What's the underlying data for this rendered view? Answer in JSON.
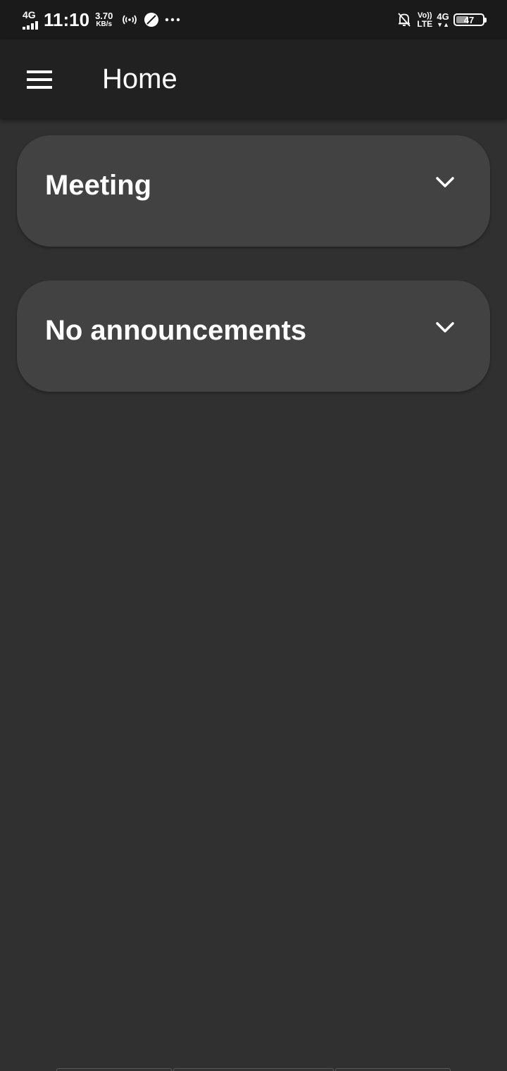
{
  "status_bar": {
    "network_left": "4G",
    "signal_level": 0.75,
    "time": "11:10",
    "speed_value": "3.70",
    "speed_unit": "KB/s",
    "volte_top": "Vo))",
    "volte_bottom": "LTE",
    "network_right": "4G",
    "network_right_arrows": "▼▲",
    "battery_percent": "47",
    "battery_level": 0.47,
    "icons": [
      "hotspot-icon",
      "leaf-app-icon",
      "more-dots-icon",
      "bell-off-icon"
    ],
    "overflow_dots": "•••"
  },
  "app_bar": {
    "title": "Home",
    "menu_icon": "hamburger-menu-icon"
  },
  "cards": [
    {
      "title": "Meeting",
      "icon": "chevron-down-icon"
    },
    {
      "title": "No announcements",
      "icon": "chevron-down-icon"
    }
  ],
  "colors": {
    "background": "#303030",
    "app_bar": "#212121",
    "status_bar": "#1a1a1a",
    "card": "#424242",
    "text": "#ffffff"
  }
}
